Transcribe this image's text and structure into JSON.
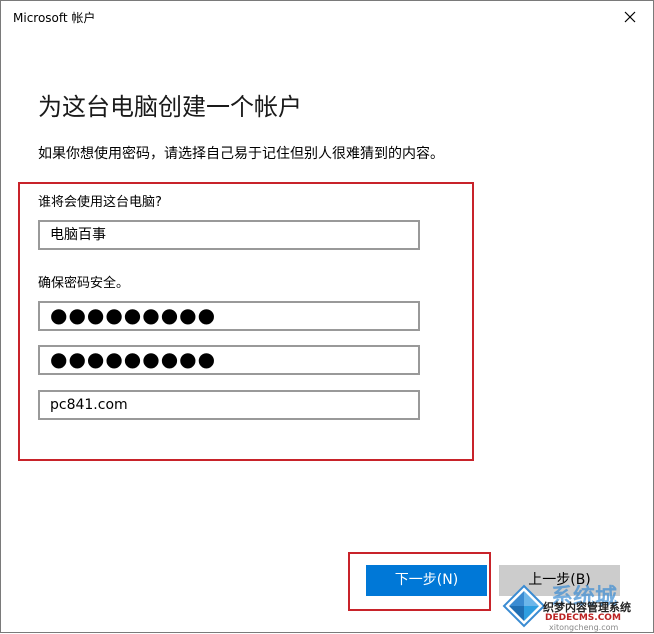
{
  "window": {
    "title": "Microsoft 帐户"
  },
  "page": {
    "heading": "为这台电脑创建一个帐户",
    "subtitle": "如果你想使用密码，请选择自己易于记住但别人很难猜到的内容。"
  },
  "form": {
    "user_label": "谁将会使用这台电脑?",
    "username_value": "电脑百事",
    "password_label": "确保密码安全。",
    "password_value": "●●●●●●●●●",
    "confirm_password_value": "●●●●●●●●●",
    "hint_value": "pc841.com"
  },
  "buttons": {
    "next_label": "下一步(N)",
    "back_label": "上一步(B)"
  },
  "watermark": {
    "text1": "织梦内容管理系统",
    "text2": "DEDECMS.COM",
    "text3": "xitongcheng.com",
    "text4": "系统城"
  },
  "colors": {
    "accent": "#0078d7",
    "highlight_border": "#c8232a"
  }
}
